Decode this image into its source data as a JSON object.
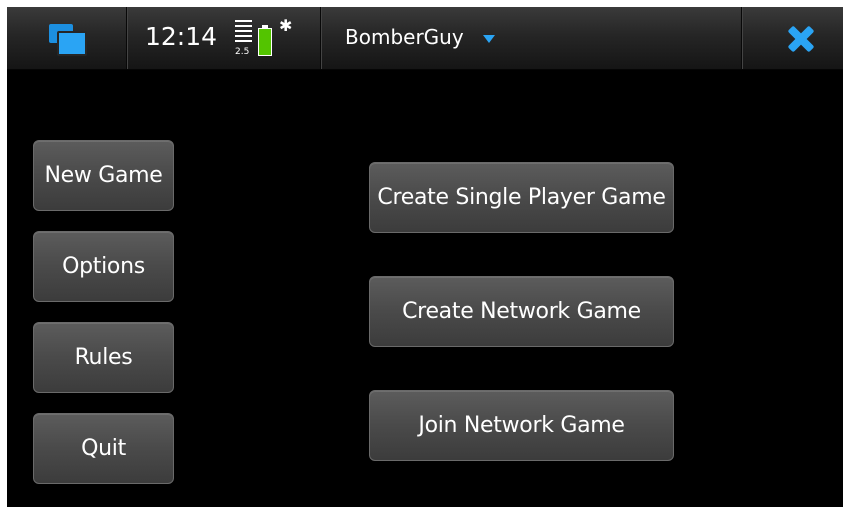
{
  "status_bar": {
    "time": "12:14",
    "signal_label": "2.5",
    "signal_strength_bars": 5,
    "battery_level": 1.0,
    "bluetooth_glyph": "✱",
    "app_title": "BomberGuy",
    "icons": {
      "task_switcher": "task-switcher-icon",
      "signal": "signal-strength-icon",
      "battery": "battery-icon",
      "bluetooth": "bluetooth-icon",
      "menu_arrow": "chevron-down-icon",
      "close": "close-icon"
    }
  },
  "side_menu": {
    "items": [
      {
        "label": "New Game"
      },
      {
        "label": "Options"
      },
      {
        "label": "Rules"
      },
      {
        "label": "Quit"
      }
    ]
  },
  "main_menu": {
    "items": [
      {
        "label": "Create Single Player Game"
      },
      {
        "label": "Create Network Game"
      },
      {
        "label": "Join Network Game"
      }
    ]
  },
  "colors": {
    "accent": "#2aa4f4",
    "battery": "#53c400",
    "background": "#000000",
    "button": "#4a4a4a"
  }
}
